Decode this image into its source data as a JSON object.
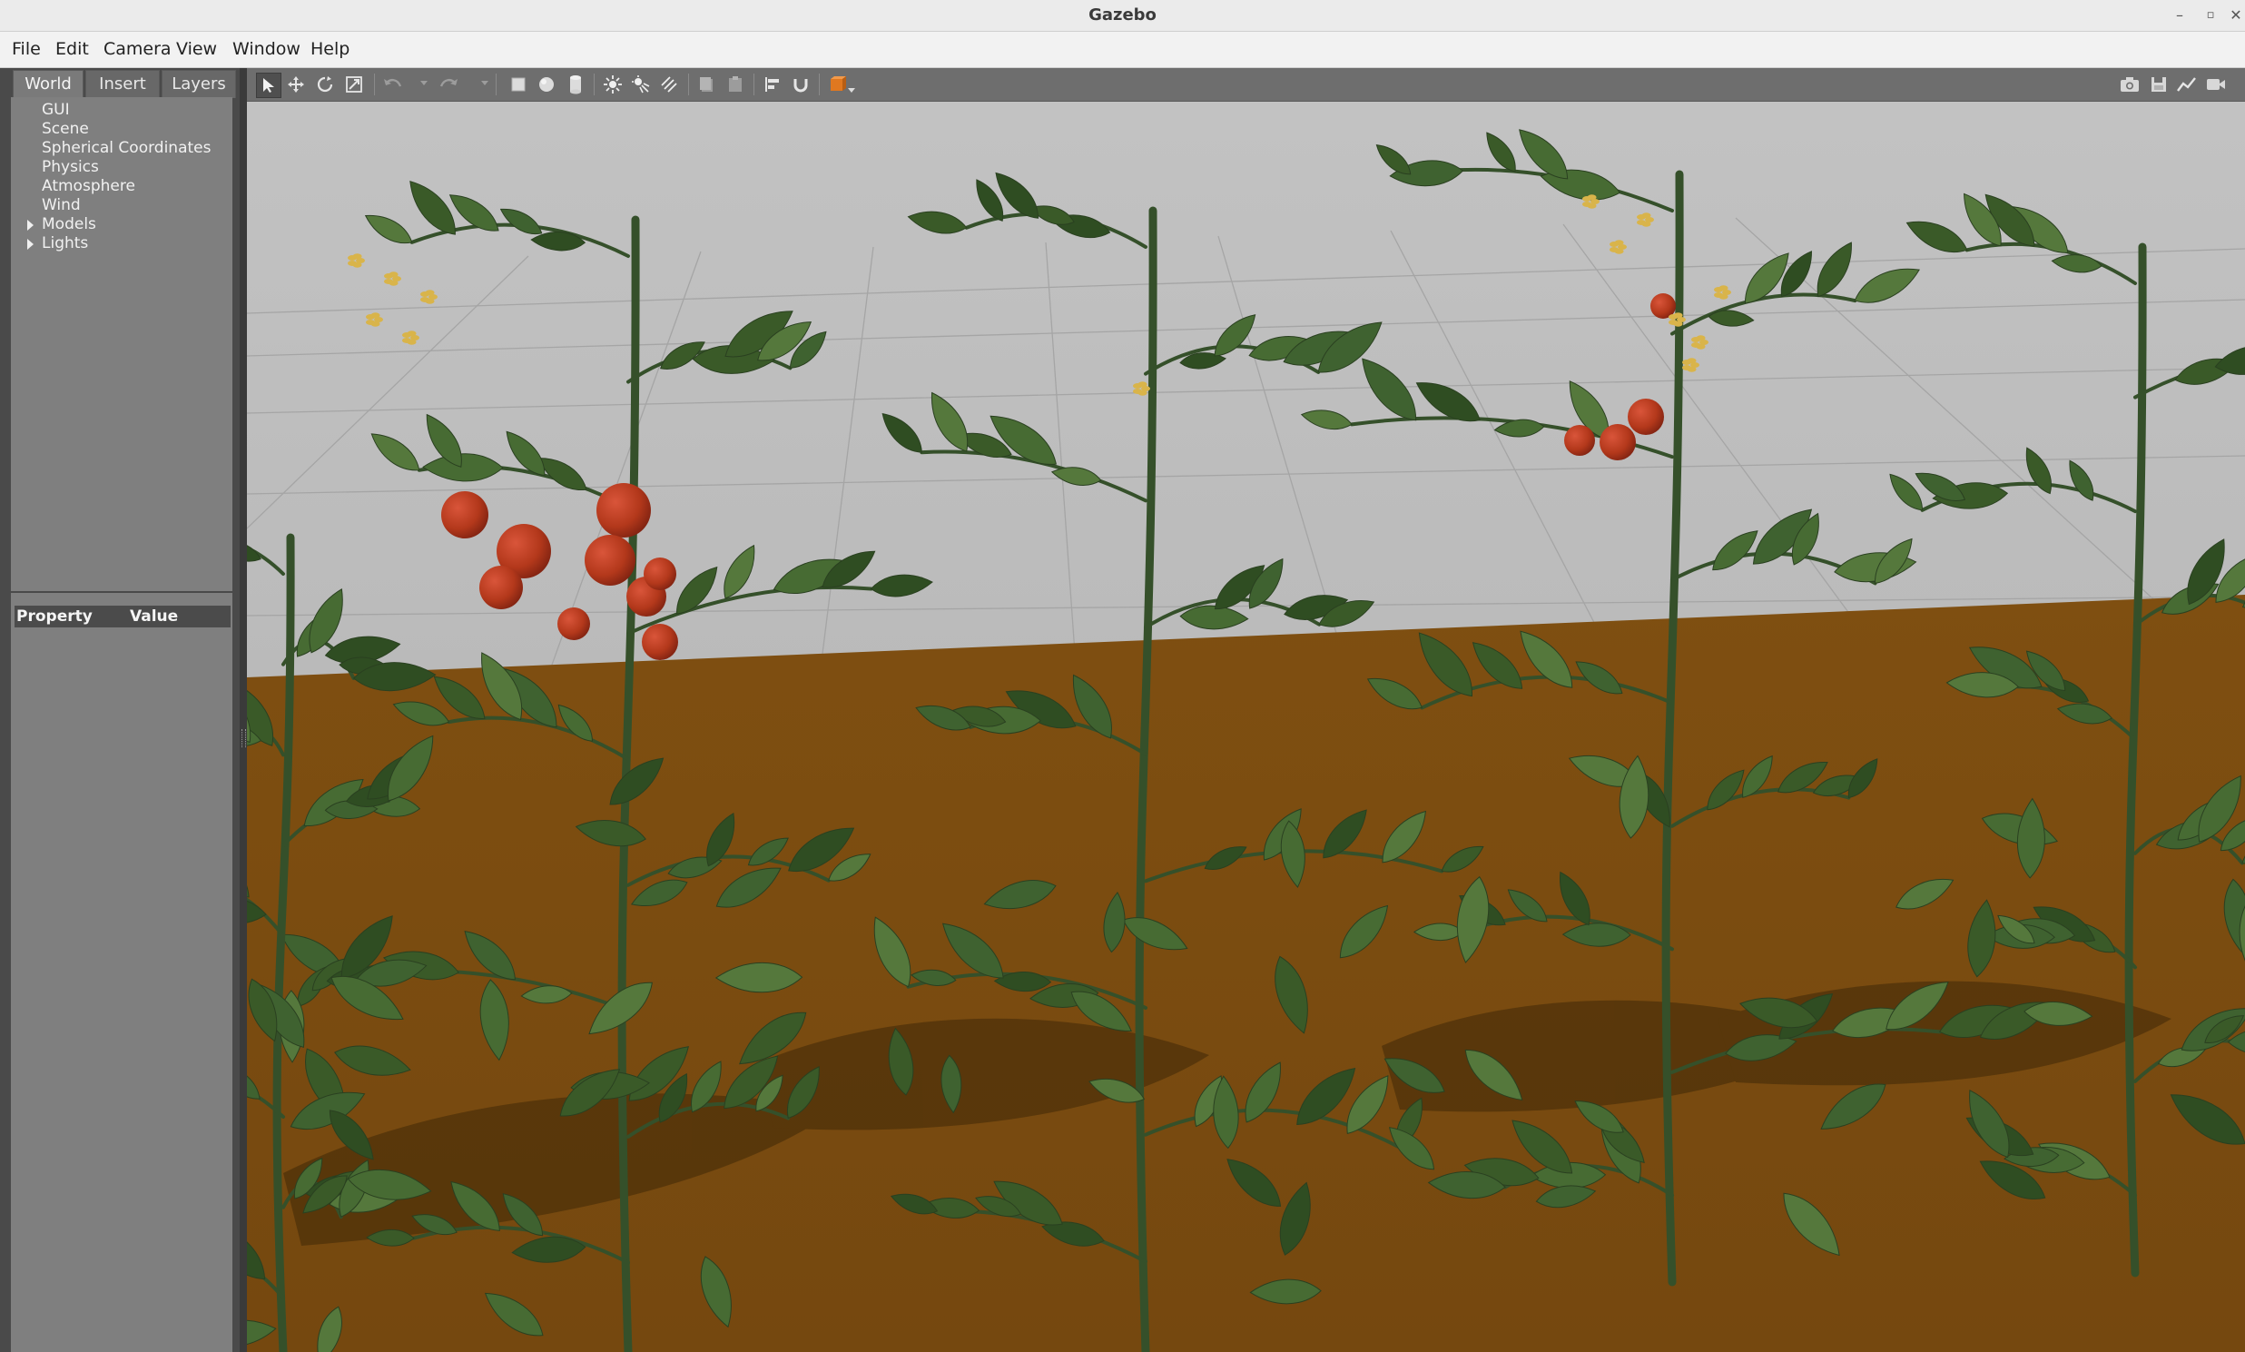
{
  "window": {
    "title": "Gazebo"
  },
  "menu": [
    {
      "label": "File"
    },
    {
      "label": "Edit"
    },
    {
      "label": "Camera"
    },
    {
      "label": "View"
    },
    {
      "label": "Window"
    },
    {
      "label": "Help"
    }
  ],
  "left_panel": {
    "tabs": [
      {
        "label": "World",
        "active": true
      },
      {
        "label": "Insert",
        "active": false
      },
      {
        "label": "Layers",
        "active": false
      }
    ],
    "tree_items": [
      {
        "label": "GUI",
        "expandable": false
      },
      {
        "label": "Scene",
        "expandable": false
      },
      {
        "label": "Spherical Coordinates",
        "expandable": false
      },
      {
        "label": "Physics",
        "expandable": false
      },
      {
        "label": "Atmosphere",
        "expandable": false
      },
      {
        "label": "Wind",
        "expandable": false
      },
      {
        "label": "Models",
        "expandable": true
      },
      {
        "label": "Lights",
        "expandable": true
      }
    ],
    "property_table": {
      "col_property": "Property",
      "col_value": "Value"
    }
  },
  "toolbar": {
    "left_tools": [
      "select-mode-icon",
      "translate-mode-icon",
      "rotate-mode-icon",
      "scale-mode-icon",
      "undo-icon",
      "redo-icon",
      "box-shape-icon",
      "sphere-shape-icon",
      "cylinder-shape-icon",
      "point-light-icon",
      "spot-light-icon",
      "directional-light-icon",
      "copy-icon",
      "paste-icon",
      "align-icon",
      "snap-icon",
      "view-angle-icon"
    ],
    "right_tools": [
      "screenshot-icon",
      "log-icon",
      "plot-icon",
      "record-video-icon"
    ]
  },
  "colors": {
    "sky": "#b9b9b9",
    "ground": "#7b4c10",
    "leaf": "#3f5f2c",
    "tomato": "#b33a1c",
    "flower": "#d9b44a",
    "panel": "#7f7f7f",
    "toolbar": "#6e6e6e"
  }
}
